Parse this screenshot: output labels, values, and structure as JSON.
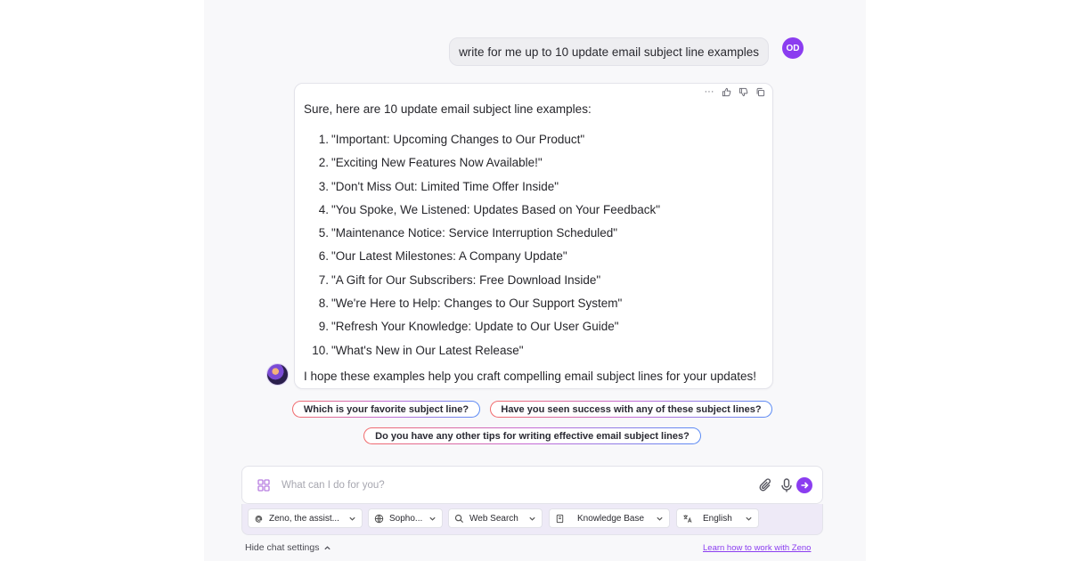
{
  "user_message": {
    "text": "write for me up to 10 update email subject line examples",
    "avatar_initials": "OD"
  },
  "assistant_message": {
    "intro": "Sure, here are 10 update email subject line examples:",
    "examples": [
      {
        "num": "1.",
        "text": "\"Important: Upcoming Changes to Our Product\""
      },
      {
        "num": "2.",
        "text": "\"Exciting New Features Now Available!\""
      },
      {
        "num": "3.",
        "text": "\"Don't Miss Out: Limited Time Offer Inside\""
      },
      {
        "num": "4.",
        "text": "\"You Spoke, We Listened: Updates Based on Your Feedback\""
      },
      {
        "num": "5.",
        "text": "\"Maintenance Notice: Service Interruption Scheduled\""
      },
      {
        "num": "6.",
        "text": "\"Our Latest Milestones: A Company Update\""
      },
      {
        "num": "7.",
        "text": "\"A Gift for Our Subscribers: Free Download Inside\""
      },
      {
        "num": "8.",
        "text": "\"We're Here to Help: Changes to Our Support System\""
      },
      {
        "num": "9.",
        "text": "\"Refresh Your Knowledge: Update to Our User Guide\""
      },
      {
        "num": "10.",
        "text": "\"What's New in Our Latest Release\""
      }
    ],
    "outro": "I hope these examples help you craft compelling email subject lines for your updates!",
    "tools": {
      "more": "···"
    }
  },
  "suggestions": [
    "Which is your favorite subject line?",
    "Have you seen success with any of these subject lines?",
    "Do you have any other tips for writing effective email subject lines?"
  ],
  "composer": {
    "placeholder": "What can I do for you?",
    "settings": {
      "assistant": "Zeno, the assist...",
      "source": "Sopho...",
      "web_search": "Web Search",
      "knowledge_base": "Knowledge Base",
      "language": "English"
    },
    "hide_settings_label": "Hide chat settings",
    "learn_link": "Learn how to work with Zeno"
  },
  "colors": {
    "accent": "#8b3df0",
    "settings_bg": "#eeeaf7"
  }
}
